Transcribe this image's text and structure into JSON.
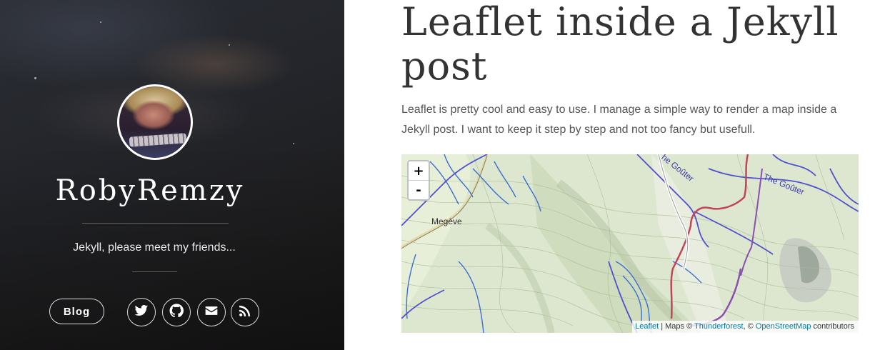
{
  "sidebar": {
    "site_name": "RobyRemzy",
    "tagline": "Jekyll, please meet my friends...",
    "blog_label": "Blog",
    "social": [
      {
        "icon": "twitter-icon"
      },
      {
        "icon": "github-icon"
      },
      {
        "icon": "envelope-icon"
      },
      {
        "icon": "rss-icon"
      }
    ]
  },
  "post": {
    "title": "Leaflet inside a Jekyll post",
    "intro": "Leaflet is pretty cool and easy to use. I manage a simple way to render a map inside a Jekyll post. I want to keep it step by step and not too fancy but usefull."
  },
  "map": {
    "zoom_in": "+",
    "zoom_out": "-",
    "place_megeve": "Megève",
    "road_label_1": "he Goûter",
    "road_label_2": "The Goûter",
    "attribution": {
      "leaflet": "Leaflet",
      "separator": " | Maps © ",
      "thunderforest": "Thunderforest",
      "comma": ", © ",
      "osm": "OpenStreetMap",
      "contributors": " contributors"
    }
  },
  "colors": {
    "route_red": "#c0455a",
    "route_purple": "#8a4fb0",
    "river_blue": "#3a6fd8",
    "terrain_green": "#cfe0c0"
  }
}
